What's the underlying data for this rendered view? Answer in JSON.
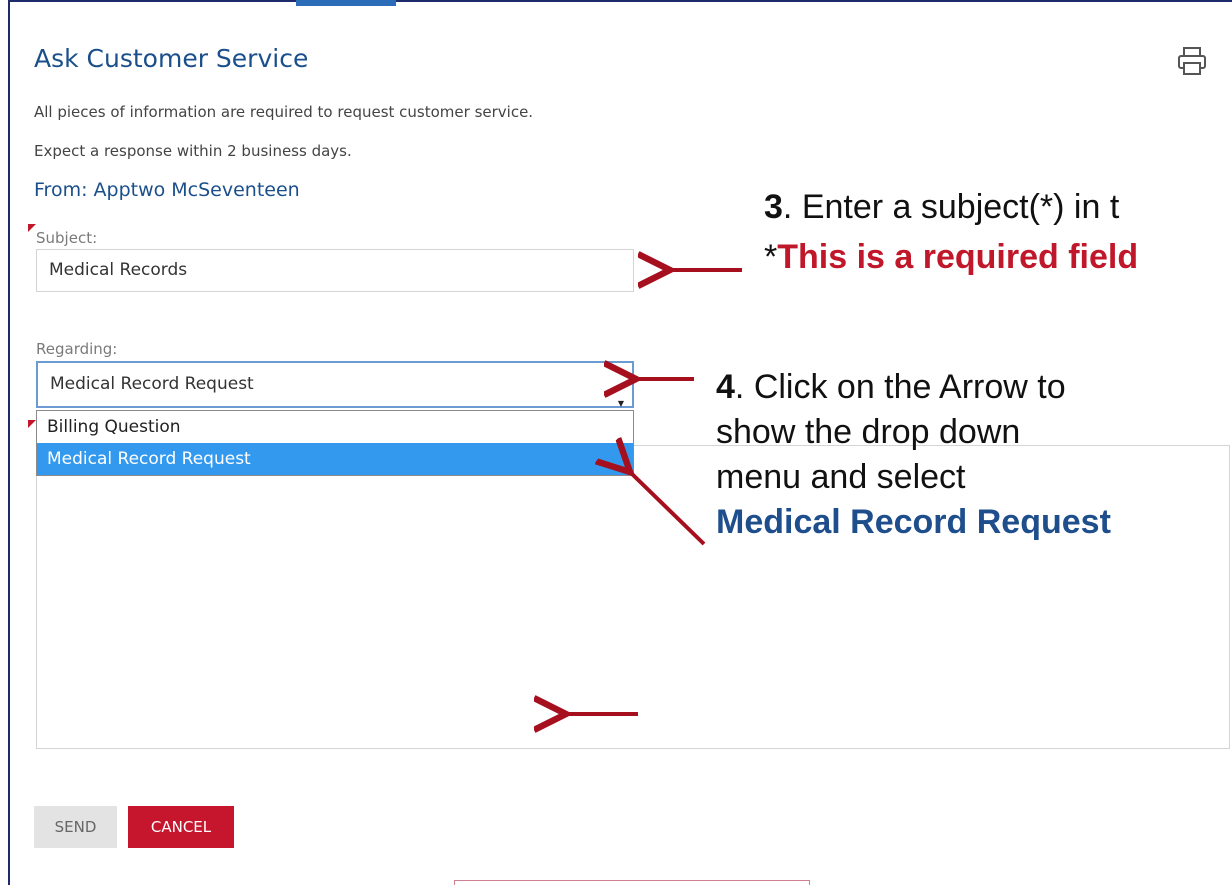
{
  "form": {
    "title": "Ask Customer Service",
    "info_line1": "All pieces of information are required to request customer service.",
    "info_line2": "Expect a response within 2 business days.",
    "from": "From: Apptwo McSeventeen",
    "subject_label": "Subject:",
    "subject_value": "Medical Records",
    "regarding_label": "Regarding:",
    "regarding_selected": "Medical Record Request",
    "regarding_options": [
      "Billing Question",
      "Medical Record Request"
    ],
    "send_label": "SEND",
    "cancel_label": "CANCEL"
  },
  "annotations": {
    "step3_num": "3",
    "step3_text": ". Enter a subject(*) in t",
    "step3_star": "*",
    "step3_required": "This is a required field",
    "step4_num": "4",
    "step4_line1": ".  Click on the Arrow to",
    "step4_line2": "show the drop down",
    "step4_line3": "menu and select",
    "step4_line4": "Medical Record Request"
  },
  "colors": {
    "title_blue": "#1a4f8b",
    "annotation_red": "#c0182a",
    "arrow_dark_red": "#a50f1e",
    "cancel_red": "#c5162e",
    "selected_blue": "#3399ee"
  },
  "icons": {
    "print": "printer-icon",
    "select_caret": "caret-down-icon",
    "required": "required-marker-icon"
  }
}
